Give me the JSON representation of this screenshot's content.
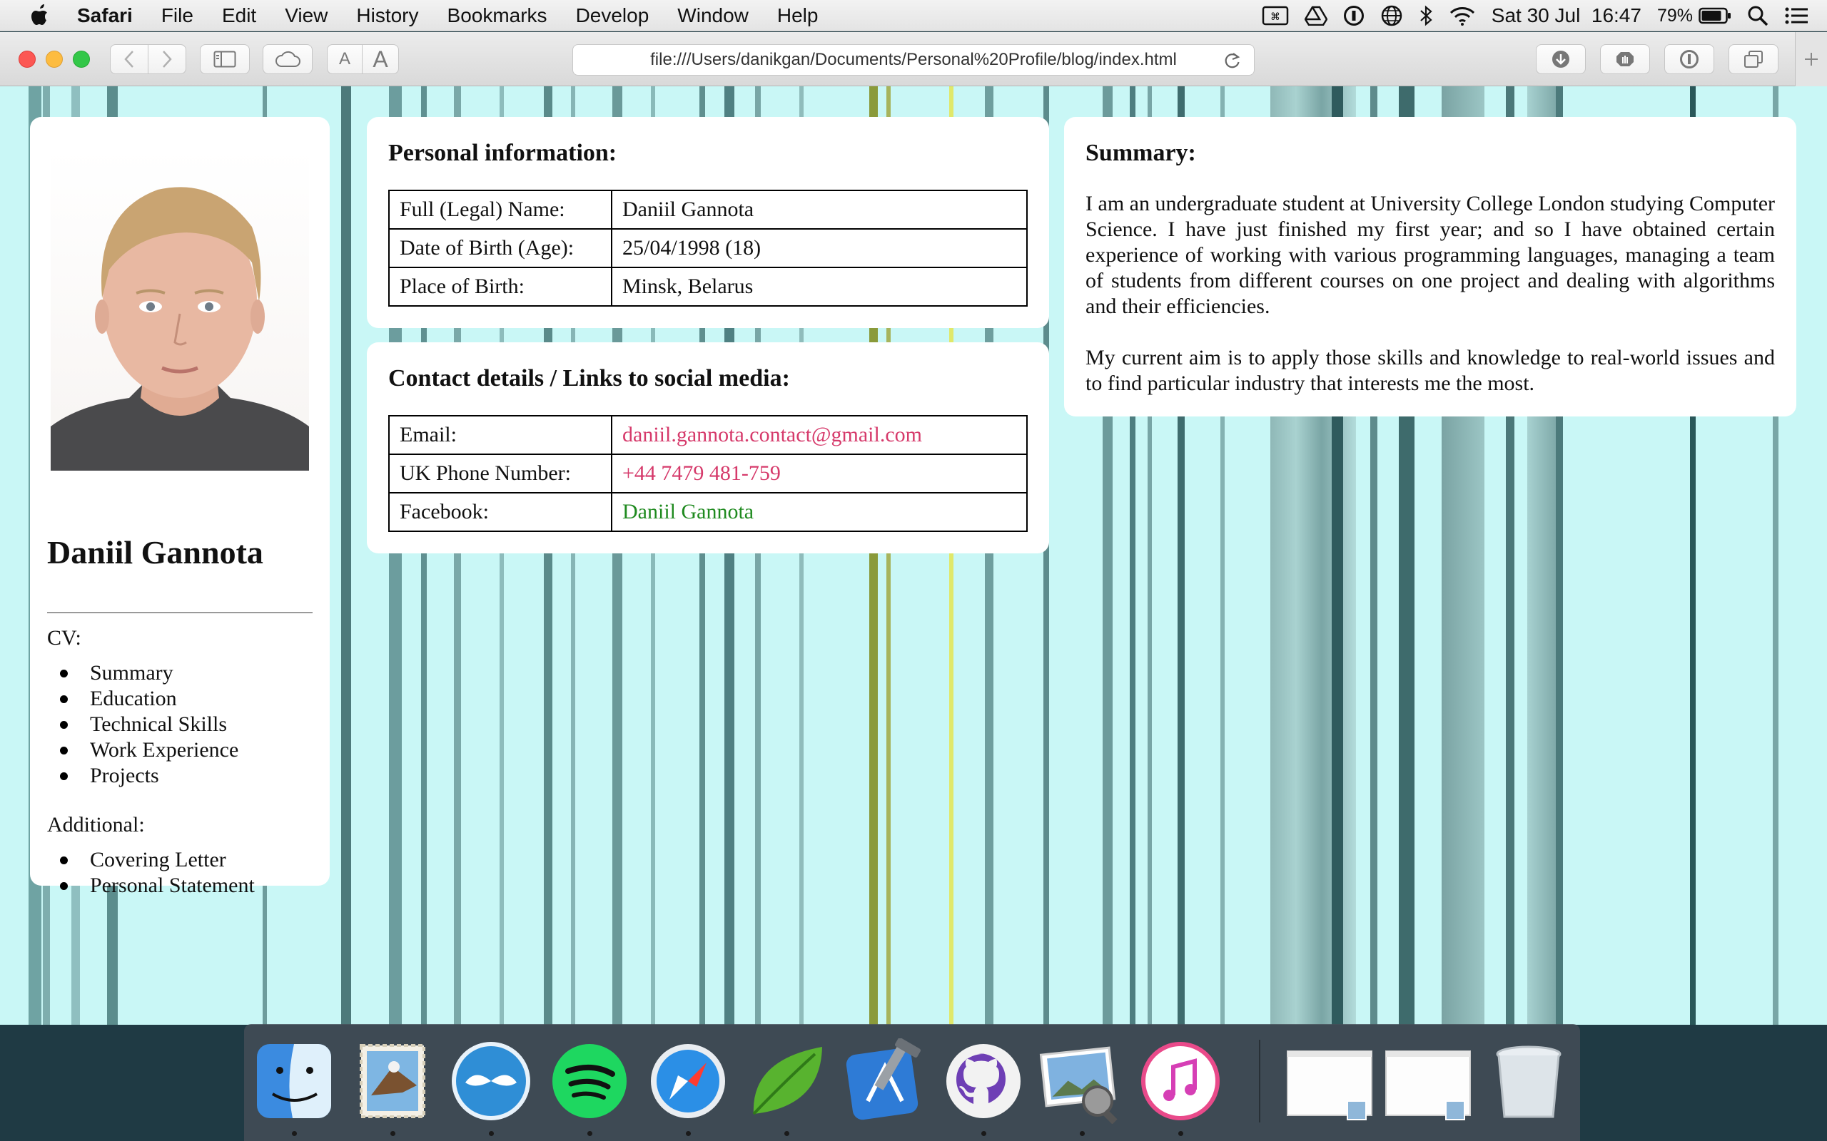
{
  "menubar": {
    "app_name": "Safari",
    "menus": [
      "File",
      "Edit",
      "View",
      "History",
      "Bookmarks",
      "Develop",
      "Window",
      "Help"
    ],
    "clock": "Sat 30 Jul  16:47",
    "battery": "79%"
  },
  "browser": {
    "url": "file:///Users/danikgan/Documents/Personal%20Profile/blog/index.html",
    "font_small": "A",
    "font_large": "A"
  },
  "profile": {
    "name": "Daniil Gannota",
    "cv_heading": "CV:",
    "cv_links": [
      "Summary",
      "Education",
      "Technical Skills",
      "Work Experience",
      "Projects"
    ],
    "additional_heading": "Additional:",
    "additional_links": [
      "Covering Letter",
      "Personal Statement"
    ]
  },
  "personal": {
    "title": "Personal information:",
    "rows": [
      {
        "label": "Full (Legal) Name:",
        "value": "Daniil Gannota"
      },
      {
        "label": "Date of Birth (Age):",
        "value": "25/04/1998 (18)"
      },
      {
        "label": "Place of Birth:",
        "value": "Minsk, Belarus"
      }
    ]
  },
  "contact": {
    "title": "Contact details / Links to social media:",
    "rows": [
      {
        "label": "Email:",
        "value": "daniil.gannota.contact@gmail.com"
      },
      {
        "label": "UK Phone Number:",
        "value": "+44 7479 481-759"
      },
      {
        "label": "Facebook:",
        "value": "Daniil Gannota"
      }
    ]
  },
  "summary": {
    "title": "Summary:",
    "paragraphs": [
      "I am an undergraduate student at University College London studying Computer Science. I have just finished my first year; and so I have obtained certain experience of working with various programming languages, managing a team of students from different courses on one project and dealing with algorithms and their efficiencies.",
      "My current aim is to apply those skills and knowledge to real-world issues and to find particular industry that interests me the most."
    ]
  },
  "dock": {
    "apps": [
      "finder-icon",
      "mail-icon",
      "mustache-app-icon",
      "spotify-icon",
      "safari-icon",
      "coda-leaf-icon",
      "xcode-icon",
      "github-desktop-icon",
      "preview-icon",
      "itunes-icon"
    ],
    "running": [
      "finder-icon",
      "mail-icon",
      "mustache-app-icon",
      "spotify-icon",
      "safari-icon",
      "coda-leaf-icon",
      "github-desktop-icon",
      "preview-icon",
      "itunes-icon"
    ],
    "documents": [
      "minimized-window-1",
      "minimized-window-2",
      "trash-icon"
    ]
  },
  "colors": {
    "page_background": "#c9f7f6",
    "link_pink": "#d63a6b",
    "link_green": "#1f8a1f"
  }
}
